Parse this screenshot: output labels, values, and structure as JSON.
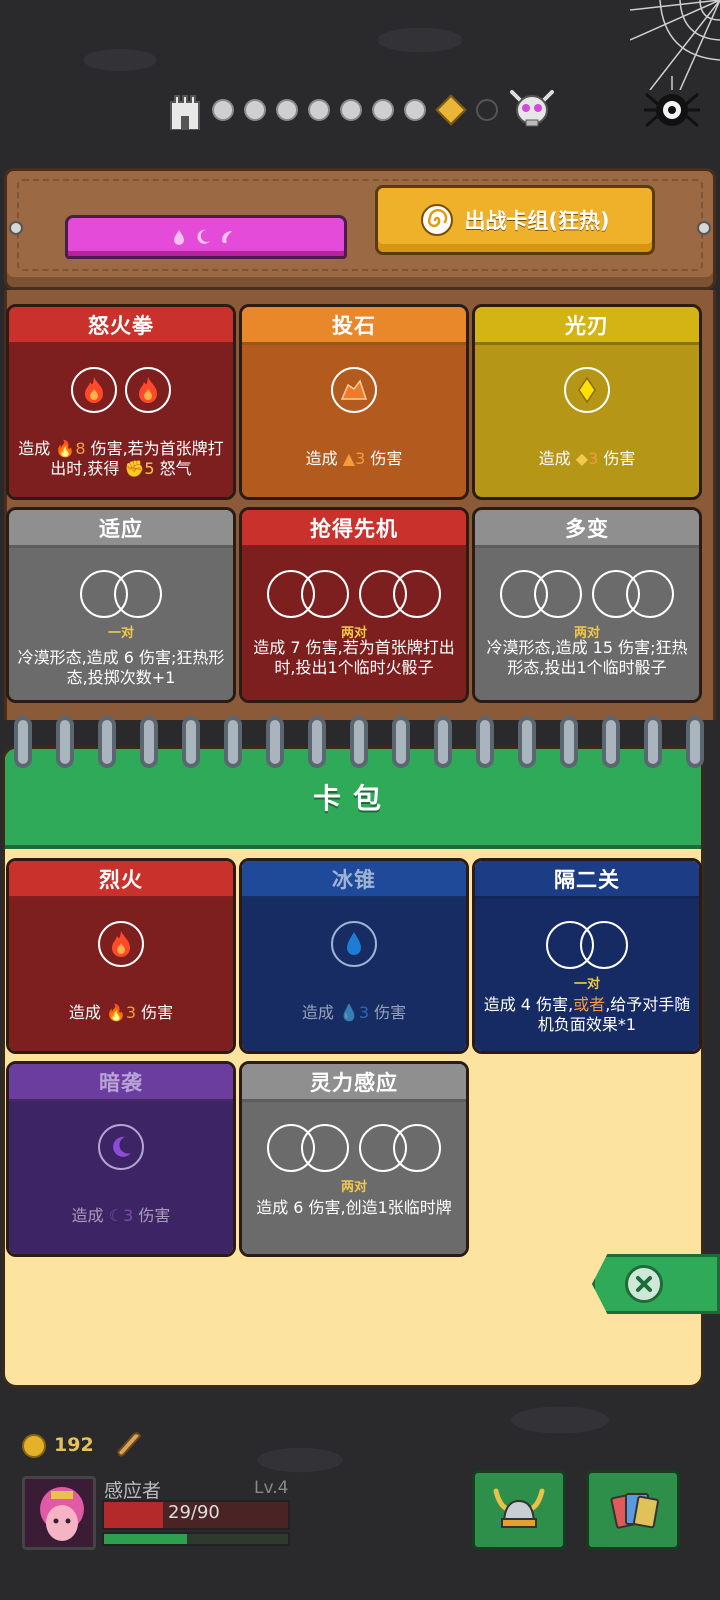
{
  "deck_header": {
    "dice_tab_label": "",
    "deck_tab_label": "出战卡组(狂热)"
  },
  "deck_cards": [
    {
      "title": "怒火拳",
      "color": "red",
      "slots": [
        "fire",
        "fire"
      ],
      "tag": "",
      "desc_prefix": "造成 ",
      "desc_num": "8",
      "desc_rest": " 伤害,若为首张牌打出时,获得 ",
      "desc_num2": "5",
      "desc_tail": " 怒气"
    },
    {
      "title": "投石",
      "color": "orange",
      "slots": [
        "rock"
      ],
      "tag": "",
      "desc_prefix": "造成 ",
      "desc_num": "3",
      "desc_rest": " 伤害"
    },
    {
      "title": "光刃",
      "color": "yellow",
      "slots": [
        "diamond"
      ],
      "tag": "",
      "desc_prefix": "造成 ",
      "desc_num": "3",
      "desc_rest": " 伤害"
    },
    {
      "title": "适应",
      "color": "gray",
      "slots": [
        "pair"
      ],
      "tag": "一对",
      "desc": "冷漠形态,造成 6 伤害;狂热形态,投掷次数+1"
    },
    {
      "title": "抢得先机",
      "color": "red",
      "slots": [
        "pair",
        "pair"
      ],
      "tag": "两对",
      "desc": "造成 7 伤害,若为首张牌打出时,投出1个临时火骰子"
    },
    {
      "title": "多变",
      "color": "gray",
      "slots": [
        "pair",
        "pair"
      ],
      "tag": "两对",
      "desc": "冷漠形态,造成 15 伤害;狂热形态,投出1个临时骰子"
    }
  ],
  "pack": {
    "title": "卡包",
    "cards": [
      {
        "title": "烈火",
        "color": "red",
        "desc_prefix": "造成 ",
        "desc_num": "3",
        "desc_rest": " 伤害"
      },
      {
        "title": "冰锥",
        "color": "blue",
        "desc_prefix": "造成 ",
        "desc_num": "3",
        "desc_rest": " 伤害"
      },
      {
        "title": "隔二关",
        "color": "darkblue",
        "tag": "一对",
        "desc_a": "造成 4 伤害,",
        "desc_b": "或者",
        "desc_c": ",给予对手随机负面效果*1"
      },
      {
        "title": "暗袭",
        "color": "purple",
        "desc_prefix": "造成 ",
        "desc_num": "3",
        "desc_rest": " 伤害"
      },
      {
        "title": "灵力感应",
        "color": "gray",
        "tag": "两对",
        "desc": "造成 6 伤害,创造1张临时牌"
      }
    ]
  },
  "player": {
    "coins": "192",
    "name": "感应者",
    "level": "Lv.4",
    "hp": "29/90",
    "hp_fraction": 0.32,
    "xp_fraction": 0.45
  },
  "colors": {
    "deck_tab": "#f0b12a",
    "dice_tab": "#e54bd9",
    "pack_header": "#2faa58"
  }
}
